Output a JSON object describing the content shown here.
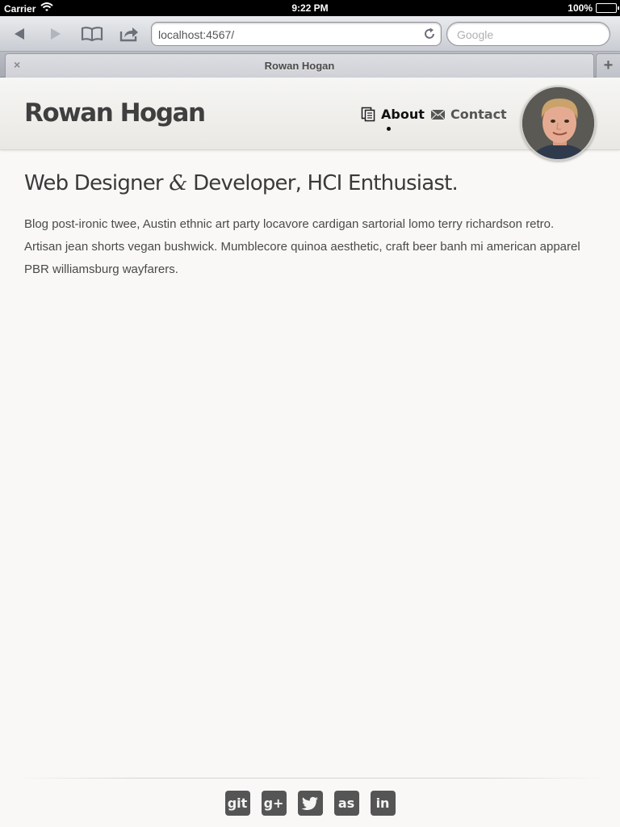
{
  "status_bar": {
    "carrier": "Carrier",
    "time": "9:22 PM",
    "battery": "100%",
    "battery_level_percent": 100
  },
  "browser": {
    "url": "localhost:4567/",
    "search_placeholder": "Google",
    "tab_title": "Rowan Hogan",
    "tab_close": "×",
    "new_tab": "+",
    "icons": [
      "back-icon",
      "forward-icon",
      "bookmarks-icon",
      "share-icon",
      "reload-icon",
      "wifi-icon"
    ]
  },
  "site": {
    "title": "Rowan Hogan",
    "nav": [
      {
        "label": "About",
        "icon": "document-icon",
        "active": true
      },
      {
        "label": "Contact",
        "icon": "envelope-icon",
        "active": false
      }
    ]
  },
  "content": {
    "headline_part1": "Web Designer ",
    "headline_amp": "&",
    "headline_part2": " Developer, HCI Enthusiast.",
    "intro": "Blog post-ironic twee, Austin ethnic art party locavore cardigan sartorial lomo terry richardson retro. Artisan jean shorts vegan bushwick. Mumblecore quinoa aesthetic, craft beer banh mi american apparel PBR williamsburg wayfarers."
  },
  "footer": {
    "social": [
      {
        "name": "github",
        "glyph": "git"
      },
      {
        "name": "google-plus",
        "glyph": "g+"
      },
      {
        "name": "twitter",
        "glyph": ""
      },
      {
        "name": "lastfm",
        "glyph": "as"
      },
      {
        "name": "linkedin",
        "glyph": "in"
      }
    ]
  },
  "colors": {
    "page_bg": "#f9f8f6",
    "text_dark": "#3f3f3f",
    "social_bg": "#555555"
  }
}
